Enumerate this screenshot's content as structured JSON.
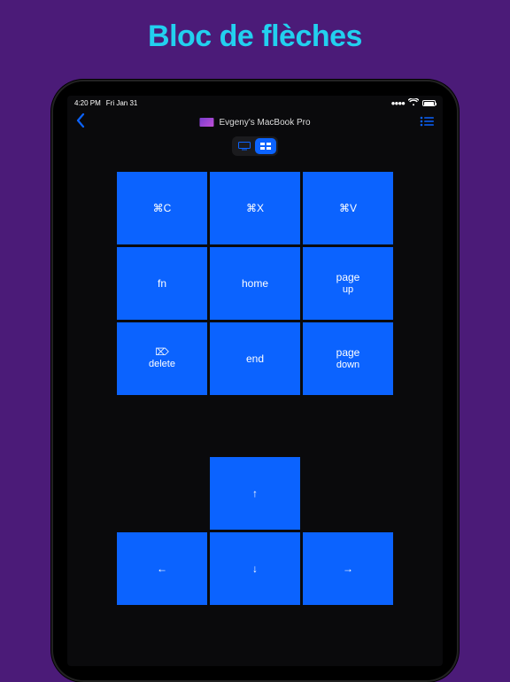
{
  "page": {
    "title": "Bloc de flèches"
  },
  "statusbar": {
    "time": "4:20 PM",
    "date": "Fri Jan 31"
  },
  "nav": {
    "device_name": "Evgeny's MacBook Pro"
  },
  "segmented": {
    "opt1_glyph": "⌨︎",
    "opt2_glyph": "⌨"
  },
  "keys": {
    "copy": "⌘C",
    "cut": "⌘X",
    "paste": "⌘V",
    "fn": "fn",
    "home": "home",
    "pageup_l1": "page",
    "pageup_l2": "up",
    "del_sym": "⌦",
    "del": "delete",
    "end": "end",
    "pagedown_l1": "page",
    "pagedown_l2": "down"
  },
  "arrows": {
    "up": "↑",
    "left": "←",
    "down": "↓",
    "right": "→"
  }
}
